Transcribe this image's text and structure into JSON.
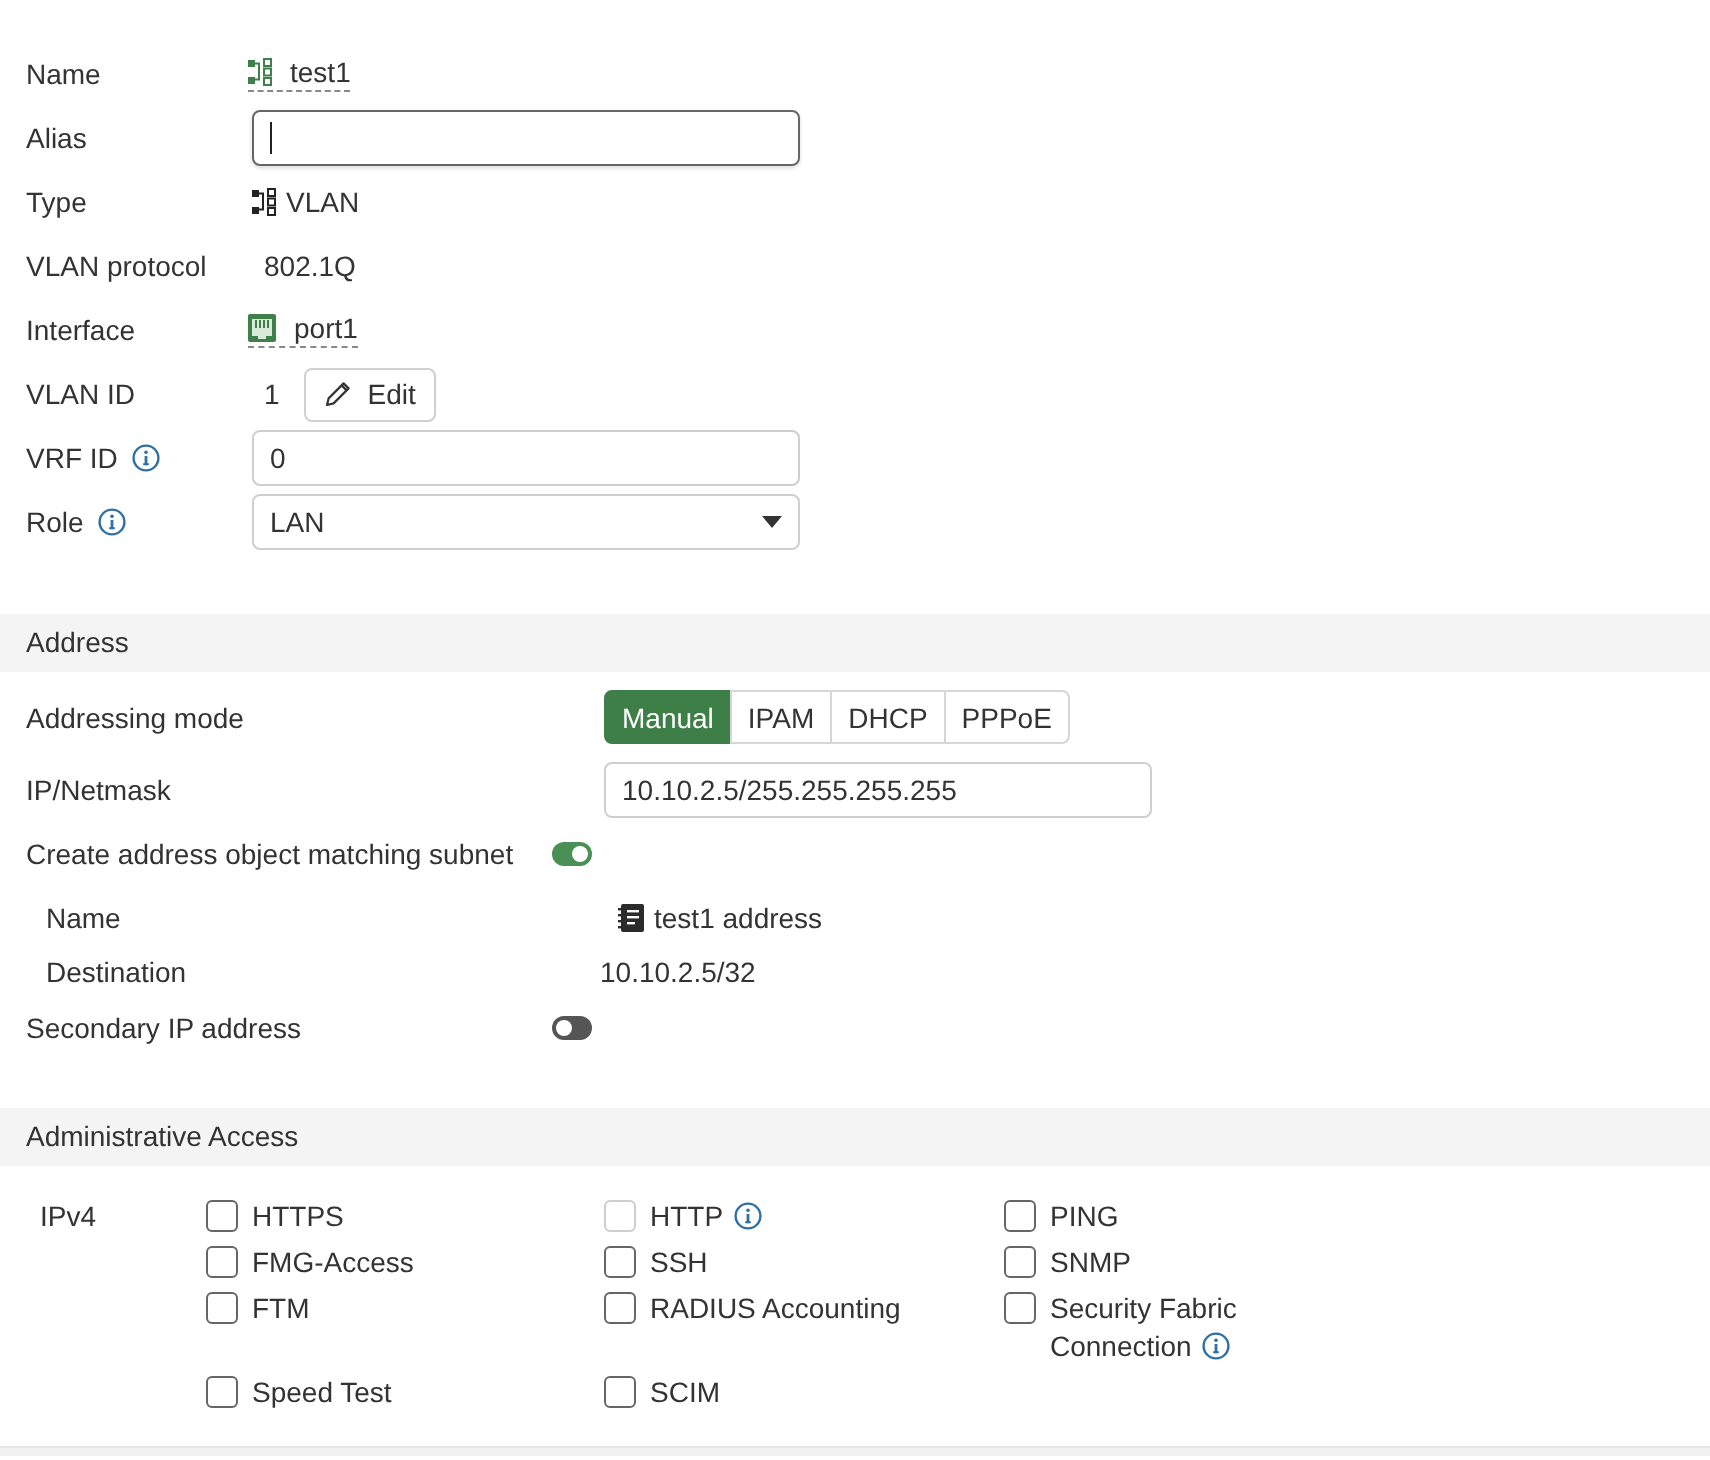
{
  "fields": [
    {
      "kind": "vlan_link",
      "label": "Name",
      "value": "test1",
      "info": false
    },
    {
      "kind": "input",
      "label": "Alias",
      "focused": true,
      "info": false
    },
    {
      "kind": "vlan_type",
      "label": "Type",
      "value": "VLAN",
      "info": false
    },
    {
      "kind": "text",
      "label": "VLAN protocol",
      "value": "802.1Q",
      "info": false
    },
    {
      "kind": "port_link",
      "label": "Interface",
      "value": "port1",
      "info": false
    },
    {
      "kind": "edit",
      "label": "VLAN ID",
      "value": "1",
      "button": "Edit",
      "info": false
    },
    {
      "kind": "input",
      "label": "VRF ID",
      "value": "0",
      "focused": false,
      "info": true
    },
    {
      "kind": "select",
      "label": "Role",
      "value": "LAN",
      "info": true
    }
  ],
  "address": {
    "title": "Address",
    "addressing_mode": {
      "label": "Addressing mode",
      "options": [
        {
          "label": "Manual",
          "selected": true
        },
        {
          "label": "IPAM",
          "selected": false
        },
        {
          "label": "DHCP",
          "selected": false
        },
        {
          "label": "PPPoE",
          "selected": false
        }
      ]
    },
    "ip_netmask": {
      "label": "IP/Netmask",
      "value": "10.10.2.5/255.255.255.255"
    },
    "create_address_object": {
      "label": "Create address object matching subnet",
      "on": true,
      "details": [
        {
          "kind": "address",
          "label": "Name",
          "value": "test1 address"
        },
        {
          "kind": "text",
          "label": "Destination",
          "value": "10.10.2.5/32"
        }
      ]
    },
    "secondary_ip": {
      "label": "Secondary IP address",
      "on": false
    }
  },
  "administrative_access": {
    "title": "Administrative Access",
    "protocol": "IPv4",
    "options": [
      {
        "label": "HTTPS",
        "checked": false,
        "disabled": false,
        "info": false
      },
      {
        "label": "HTTP",
        "checked": false,
        "disabled": true,
        "info": true
      },
      {
        "label": "PING",
        "checked": false,
        "disabled": false,
        "info": false
      },
      {
        "label": "FMG-Access",
        "checked": false,
        "disabled": false,
        "info": false
      },
      {
        "label": "SSH",
        "checked": false,
        "disabled": false,
        "info": false
      },
      {
        "label": "SNMP",
        "checked": false,
        "disabled": false,
        "info": false
      },
      {
        "label": "FTM",
        "checked": false,
        "disabled": false,
        "info": false
      },
      {
        "label": "RADIUS Accounting",
        "checked": false,
        "disabled": false,
        "info": false
      },
      {
        "label": "Security Fabric Connection",
        "checked": false,
        "disabled": false,
        "info": true
      },
      {
        "label": "Speed Test",
        "checked": false,
        "disabled": false,
        "info": false
      },
      {
        "label": "SCIM",
        "checked": false,
        "disabled": false,
        "info": false
      }
    ]
  }
}
